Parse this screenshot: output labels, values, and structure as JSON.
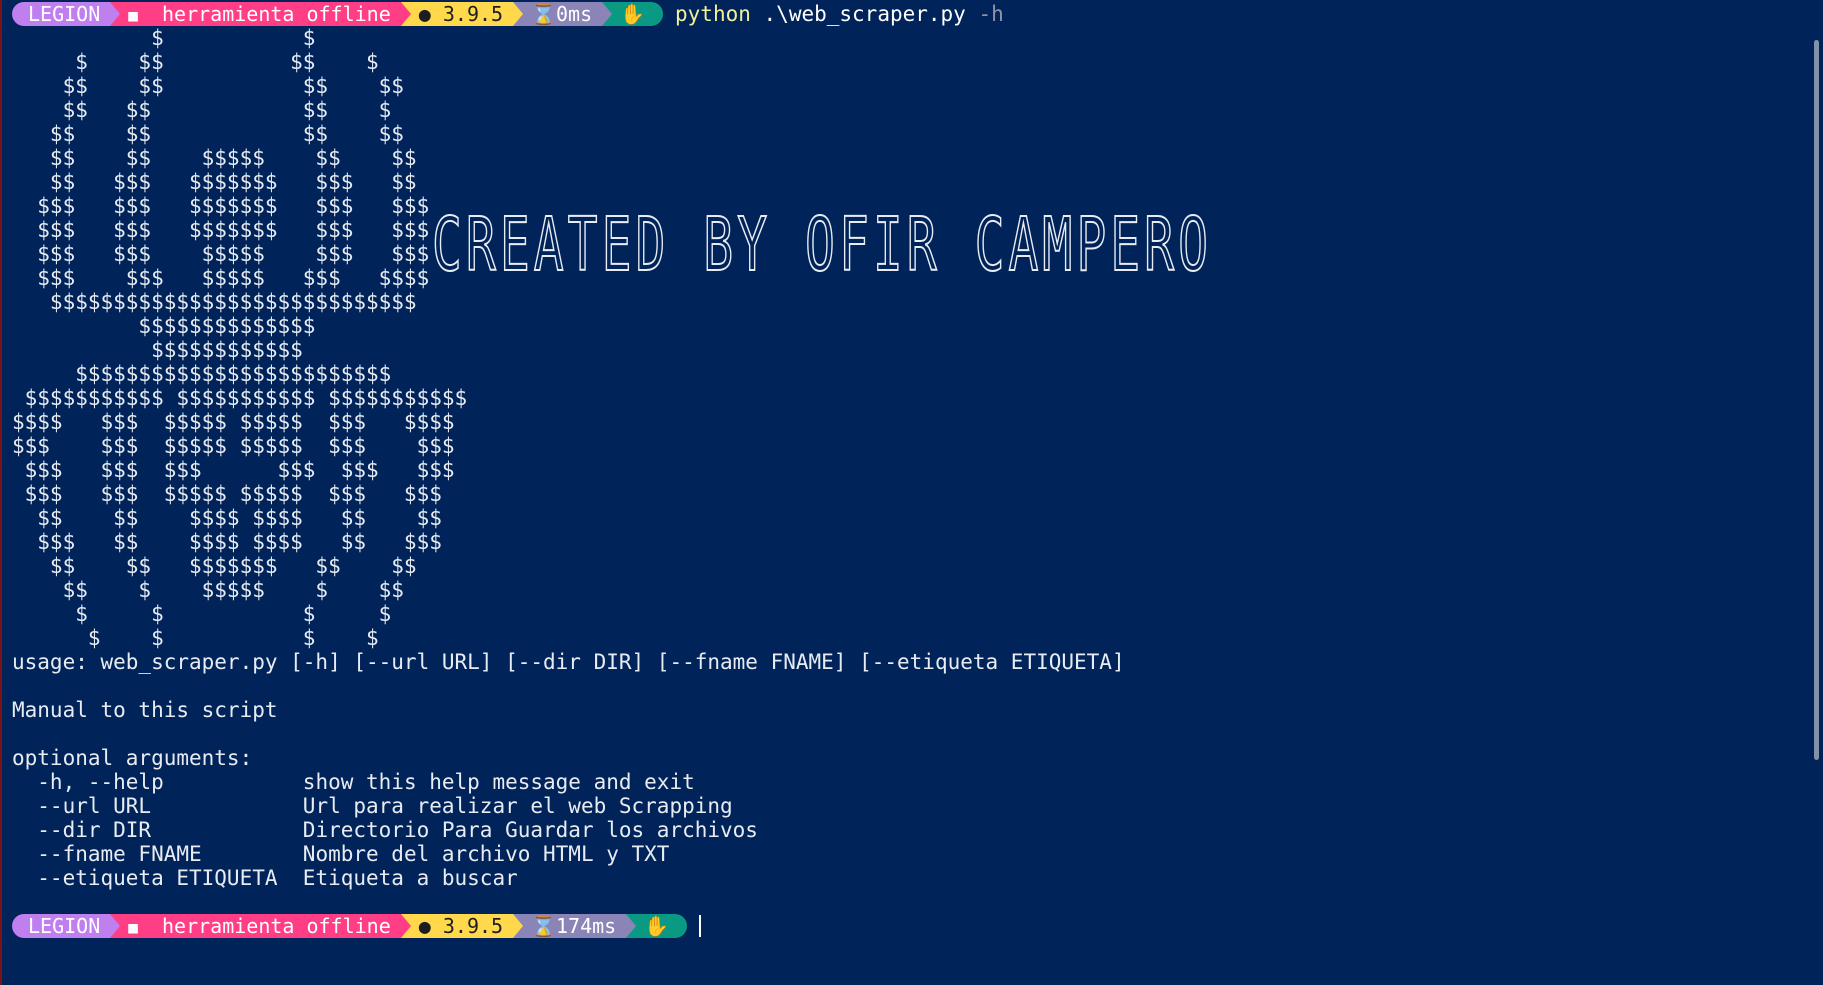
{
  "prompt_top": {
    "user": "LEGION",
    "folder_icon": "folder-icon",
    "dir": "herramienta offline",
    "py_icon": "python-dot-icon",
    "py_version": "3.9.5",
    "timer_icon": "hourglass-icon",
    "elapsed": "0ms",
    "status_icon": "hand-icon",
    "command_bin": "python",
    "command_arg": ".\\web_scraper.py",
    "command_flag": "-h"
  },
  "ascii_art": [
    "           $           $",
    "     $    $$          $$    $",
    "    $$    $$           $$    $$",
    "    $$   $$            $$    $",
    "   $$    $$            $$    $$",
    "   $$    $$    $$$$$    $$    $$",
    "   $$   $$$   $$$$$$$   $$$   $$",
    "  $$$   $$$   $$$$$$$   $$$   $$$",
    "  $$$   $$$   $$$$$$$   $$$   $$$",
    "  $$$   $$$    $$$$$    $$$   $$$",
    "  $$$    $$$   $$$$$   $$$   $$$$",
    "   $$$$$$$$$$$$$$$$$$$$$$$$$$$$$",
    "          $$$$$$$$$$$$$$",
    "           $$$$$$$$$$$$",
    "     $$$$$$$$$$$$$$$$$$$$$$$$$",
    " $$$$$$$$$$$ $$$$$$$$$$$ $$$$$$$$$$$",
    "$$$$   $$$  $$$$$ $$$$$  $$$   $$$$",
    "$$$    $$$  $$$$$ $$$$$  $$$    $$$",
    " $$$   $$$  $$$      $$$  $$$   $$$",
    " $$$   $$$  $$$$$ $$$$$  $$$   $$$",
    "  $$    $$    $$$$ $$$$   $$    $$",
    "  $$$   $$    $$$$ $$$$   $$   $$$",
    "   $$    $$   $$$$$$$   $$    $$",
    "    $$    $    $$$$$    $    $$",
    "     $     $           $     $",
    "      $    $           $    $"
  ],
  "banner_text": "CREATED BY OFIR CAMPERO",
  "help_output": {
    "usage": "usage: web_scraper.py [-h] [--url URL] [--dir DIR] [--fname FNAME] [--etiqueta ETIQUETA]",
    "description": "Manual to this script",
    "section_title": "optional arguments:",
    "options": [
      {
        "flag": "  -h, --help           ",
        "desc": "show this help message and exit"
      },
      {
        "flag": "  --url URL            ",
        "desc": "Url para realizar el web Scrapping"
      },
      {
        "flag": "  --dir DIR            ",
        "desc": "Directorio Para Guardar los archivos"
      },
      {
        "flag": "  --fname FNAME        ",
        "desc": "Nombre del archivo HTML y TXT"
      },
      {
        "flag": "  --etiqueta ETIQUETA  ",
        "desc": "Etiqueta a buscar"
      }
    ]
  },
  "prompt_bottom": {
    "user": "LEGION",
    "dir": "herramienta offline",
    "py_version": "3.9.5",
    "elapsed": "174ms"
  },
  "colors": {
    "background": "#00245a",
    "legion": "#bf7fee",
    "dir": "#ff3e86",
    "python": "#ffd94b",
    "timer": "#8b84b6",
    "status": "#0a9a84"
  }
}
